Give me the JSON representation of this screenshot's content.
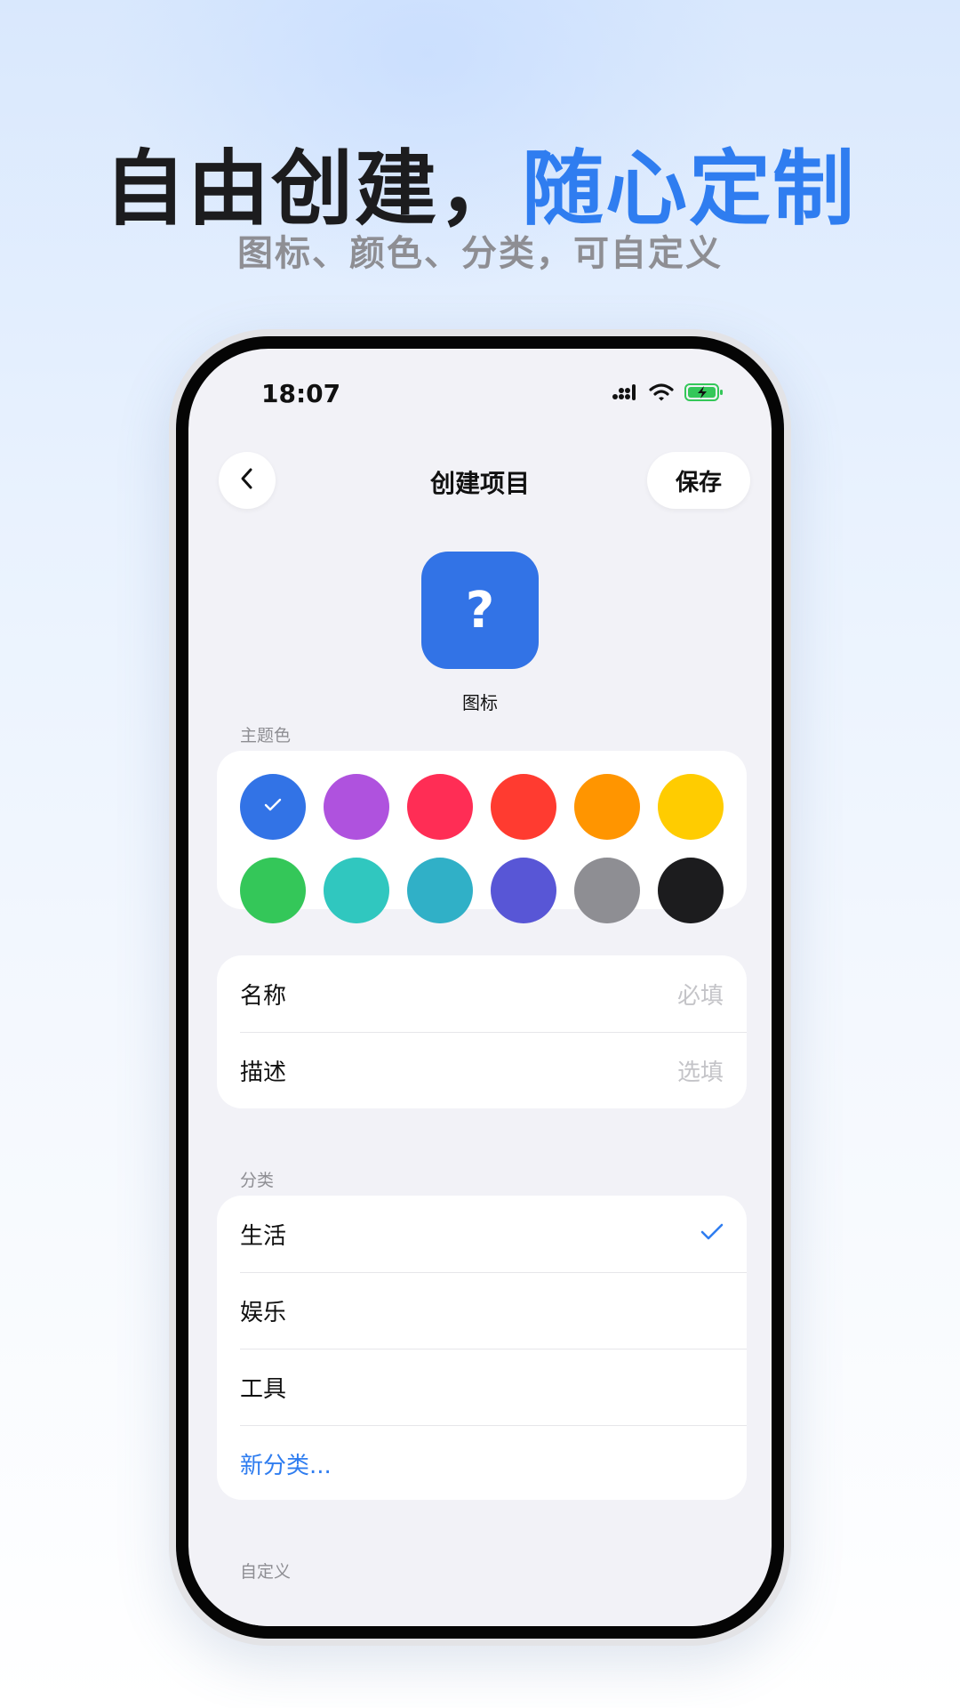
{
  "hero": {
    "title_main": "自由创建，",
    "title_accent": "随心定制",
    "subtitle": "图标、颜色、分类，可自定义",
    "accent_color": "#2f7df0"
  },
  "status_bar": {
    "time": "18:07",
    "icons": [
      "signal-icon",
      "wifi-icon",
      "battery-charging-icon"
    ]
  },
  "nav": {
    "back_icon": "chevron-left-icon",
    "title": "创建项目",
    "save_label": "保存"
  },
  "icon_picker": {
    "glyph": "?",
    "label": "图标",
    "color": "#3273e6"
  },
  "theme": {
    "section_label": "主题色",
    "selected_index": 0,
    "colors": [
      "#3273e6",
      "#af52de",
      "#ff2d55",
      "#ff3b30",
      "#ff9500",
      "#ffcc00",
      "#34c759",
      "#30c7bf",
      "#30b0c7",
      "#5856d6",
      "#8e8e93",
      "#1c1c1e"
    ]
  },
  "fields": [
    {
      "label": "名称",
      "placeholder": "必填"
    },
    {
      "label": "描述",
      "placeholder": "选填"
    }
  ],
  "category": {
    "section_label": "分类",
    "items": [
      {
        "label": "生活",
        "selected": true
      },
      {
        "label": "娱乐",
        "selected": false
      },
      {
        "label": "工具",
        "selected": false
      }
    ],
    "new_label": "新分类..."
  },
  "custom": {
    "section_label": "自定义"
  }
}
